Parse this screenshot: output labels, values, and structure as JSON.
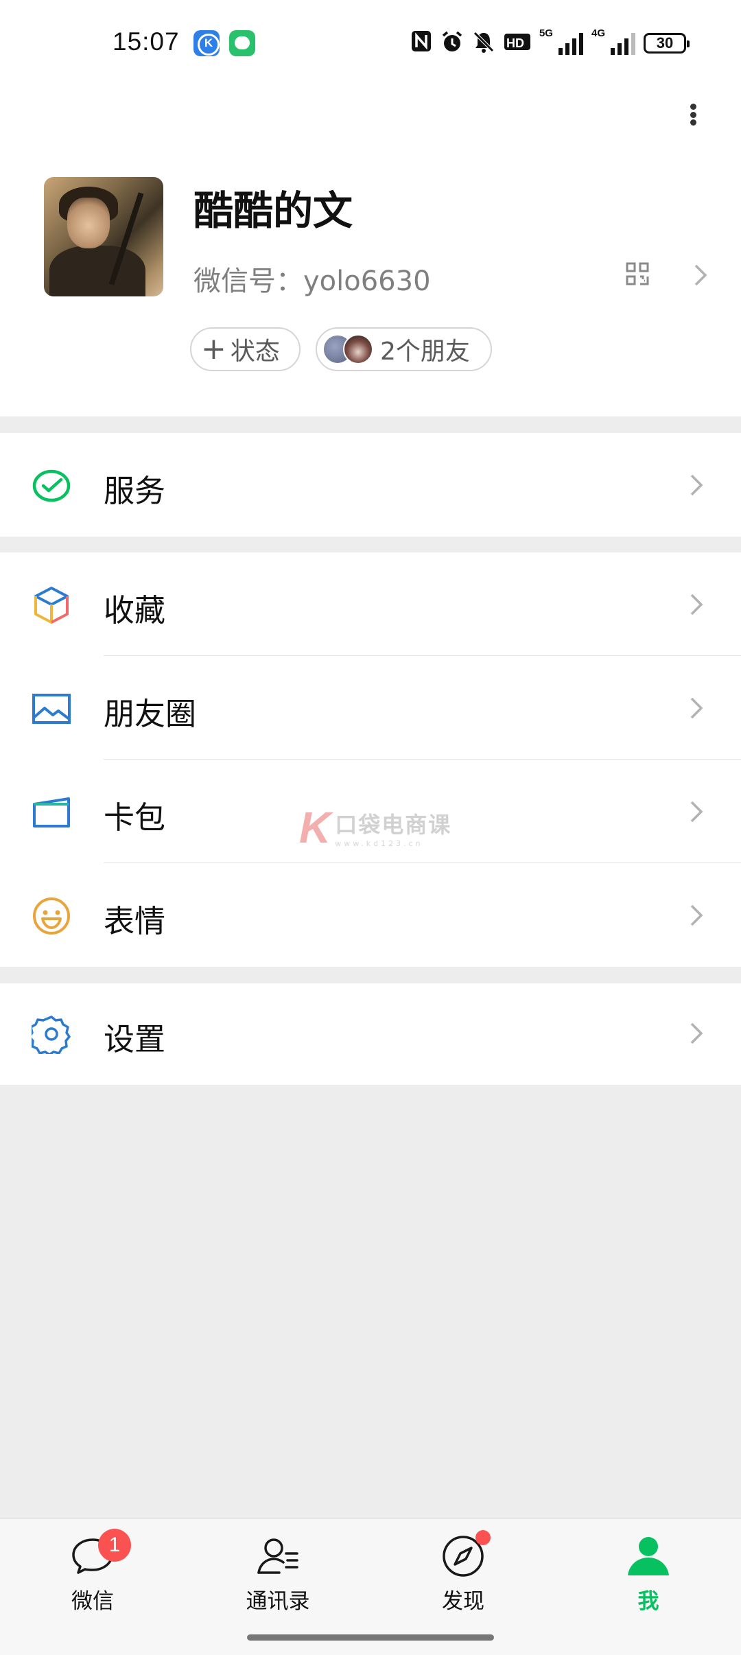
{
  "status_bar": {
    "time": "15:07",
    "network_5g": "5G",
    "network_4g": "4G",
    "battery": "30",
    "icons": [
      "k-app-icon",
      "message-app-icon",
      "nfc-icon",
      "alarm-icon",
      "mute-icon",
      "hd-icon",
      "signal-icon",
      "battery-icon"
    ]
  },
  "profile": {
    "nickname": "酷酷的文",
    "wechat_id": "微信号：yolo6630",
    "status_button": "状态",
    "friends_button": "2个朋友"
  },
  "menu": {
    "services": "服务",
    "favorites": "收藏",
    "moments": "朋友圈",
    "cards": "卡包",
    "stickers": "表情",
    "settings": "设置"
  },
  "colors": {
    "accent": "#07c160",
    "badge": "#fa5151",
    "services_icon": "#07c160",
    "moments_icon": "#2b7bd1",
    "stickers_icon": "#e9a43c"
  },
  "watermark": {
    "title": "口袋电商课",
    "url": "www.kd123.cn"
  },
  "tabbar": {
    "tabs": [
      {
        "label": "微信",
        "badge": "1"
      },
      {
        "label": "通讯录"
      },
      {
        "label": "发现"
      },
      {
        "label": "我"
      }
    ]
  }
}
